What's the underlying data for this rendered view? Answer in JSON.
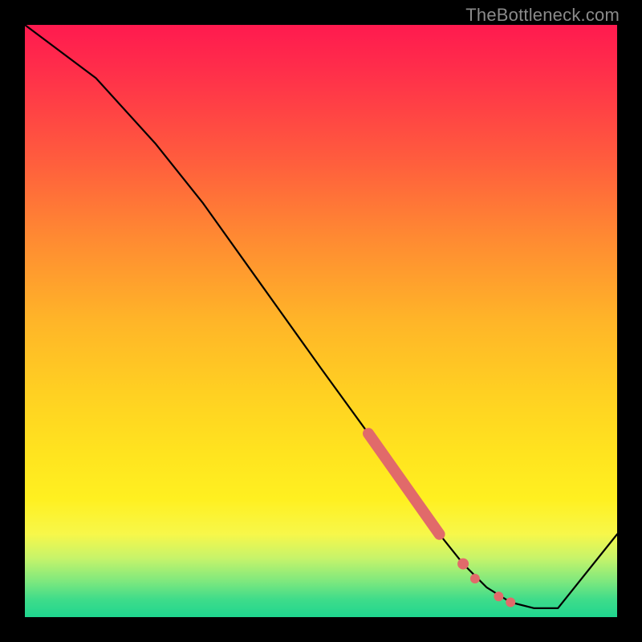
{
  "attribution": "TheBottleneck.com",
  "chart_data": {
    "type": "line",
    "title": "",
    "xlabel": "",
    "ylabel": "",
    "xlim": [
      0,
      100
    ],
    "ylim": [
      0,
      100
    ],
    "grid": false,
    "series": [
      {
        "name": "curve",
        "color": "#000000",
        "x": [
          0,
          12,
          22,
          30,
          40,
          50,
          58,
          65,
          70,
          74,
          78,
          82,
          86,
          90,
          100
        ],
        "y": [
          100,
          91,
          80,
          70,
          56,
          42,
          31,
          21,
          14,
          9,
          5,
          2.5,
          1.5,
          1.5,
          14
        ]
      }
    ],
    "highlight_segment": {
      "color": "#e16a6a",
      "width_thick": 14,
      "points_thick": [
        {
          "x": 58,
          "y": 31
        },
        {
          "x": 70,
          "y": 14
        }
      ],
      "dots": [
        {
          "x": 74,
          "y": 9
        },
        {
          "x": 76,
          "y": 6.5
        },
        {
          "x": 80,
          "y": 3.5
        },
        {
          "x": 82,
          "y": 2.5
        }
      ]
    }
  }
}
